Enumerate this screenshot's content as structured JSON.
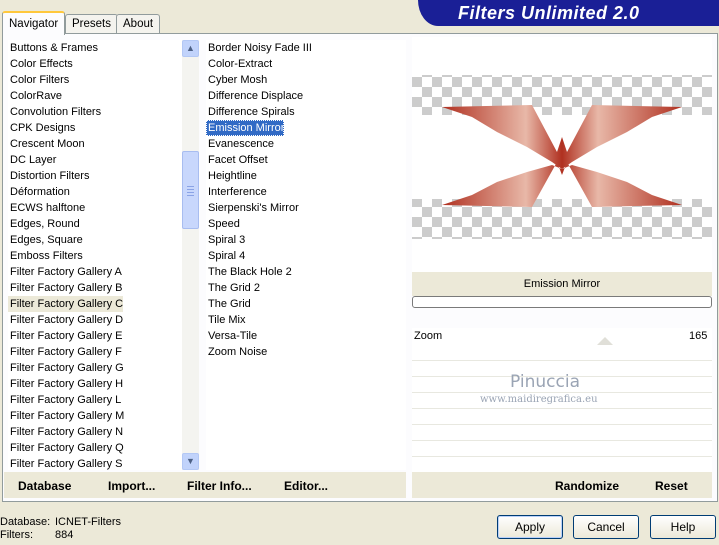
{
  "app": {
    "title": "Filters Unlimited 2.0"
  },
  "tabs": [
    {
      "label": "Navigator",
      "active": true
    },
    {
      "label": "Presets",
      "active": false
    },
    {
      "label": "About",
      "active": false
    }
  ],
  "categories": [
    "Buttons & Frames",
    "Color Effects",
    "Color Filters",
    "ColorRave",
    "Convolution Filters",
    "CPK Designs",
    "Crescent Moon",
    "DC Layer",
    "Distortion Filters",
    "Déformation",
    "ECWS halftone",
    "Edges, Round",
    "Edges, Square",
    "Emboss Filters",
    "Filter Factory Gallery A",
    "Filter Factory Gallery B",
    "Filter Factory Gallery C",
    "Filter Factory Gallery D",
    "Filter Factory Gallery E",
    "Filter Factory Gallery F",
    "Filter Factory Gallery G",
    "Filter Factory Gallery H",
    "Filter Factory Gallery L",
    "Filter Factory Gallery M",
    "Filter Factory Gallery N",
    "Filter Factory Gallery Q",
    "Filter Factory Gallery S"
  ],
  "selected_category": "Filter Factory Gallery C",
  "filters": [
    "Border Noisy Fade III",
    "Color-Extract",
    "Cyber Mosh",
    "Difference Displace",
    "Difference Spirals",
    "Emission Mirror",
    "Evanescence",
    "Facet Offset",
    "Heightline",
    "Interference",
    "Sierpenski's Mirror",
    "Speed",
    "Spiral 3",
    "Spiral 4",
    "The Black Hole 2",
    "The Grid 2",
    "The Grid",
    "Tile Mix",
    "Versa-Tile",
    "Zoom Noise"
  ],
  "selected_filter": "Emission Mirror",
  "preview": {
    "filter_name": "Emission Mirror"
  },
  "params": [
    {
      "name": "Zoom",
      "value": "165"
    }
  ],
  "watermark": {
    "line1": "Pinuccia",
    "line2": "www.maidiregrafica.eu"
  },
  "bottom_links": {
    "database": "Database",
    "import": "Import...",
    "filter_info": "Filter Info...",
    "editor": "Editor..."
  },
  "preview_buttons": {
    "randomize": "Randomize",
    "reset": "Reset"
  },
  "status": {
    "database_label": "Database:",
    "database_value": "ICNET-Filters",
    "filters_label": "Filters:",
    "filters_value": "884"
  },
  "buttons": {
    "apply": "Apply",
    "cancel": "Cancel",
    "help": "Help"
  },
  "colors": {
    "header": "#1a1f96",
    "selection": "#316ac5",
    "mirror_dark": "#b03020"
  }
}
